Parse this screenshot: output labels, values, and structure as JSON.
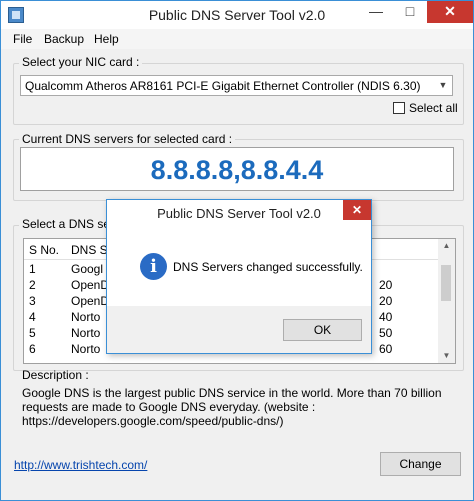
{
  "window": {
    "title": "Public DNS Server Tool v2.0"
  },
  "menu": [
    "File",
    "Backup",
    "Help"
  ],
  "nic": {
    "label": "Select your NIC card :",
    "selected": "Qualcomm Atheros AR8161 PCI-E Gigabit Ethernet Controller (NDIS 6.30)",
    "select_all": "Select all"
  },
  "current_dns": {
    "label": "Current DNS servers for selected card :",
    "value": "8.8.8.8,8.8.4.4"
  },
  "dns_list": {
    "label": "Select a DNS se",
    "columns": [
      "S No.",
      "DNS S"
    ],
    "rows": [
      {
        "sno": "1",
        "name": "Googl",
        "tail": ""
      },
      {
        "sno": "2",
        "name": "OpenD",
        "tail": "20"
      },
      {
        "sno": "3",
        "name": "OpenD",
        "tail": "20"
      },
      {
        "sno": "4",
        "name": "Norto",
        "tail": "40"
      },
      {
        "sno": "5",
        "name": "Norto",
        "tail": "50"
      },
      {
        "sno": "6",
        "name": "Norto",
        "tail": "60"
      }
    ]
  },
  "description": {
    "label": "Description :",
    "text": "Google DNS is the largest public DNS service in the world. More than 70 billion requests are made to Google DNS everyday. (website : https://developers.google.com/speed/public-dns/)"
  },
  "link": "http://www.trishtech.com/",
  "change_button": "Change",
  "dialog": {
    "title": "Public DNS Server Tool v2.0",
    "message": "DNS Servers changed successfully.",
    "ok": "OK"
  }
}
